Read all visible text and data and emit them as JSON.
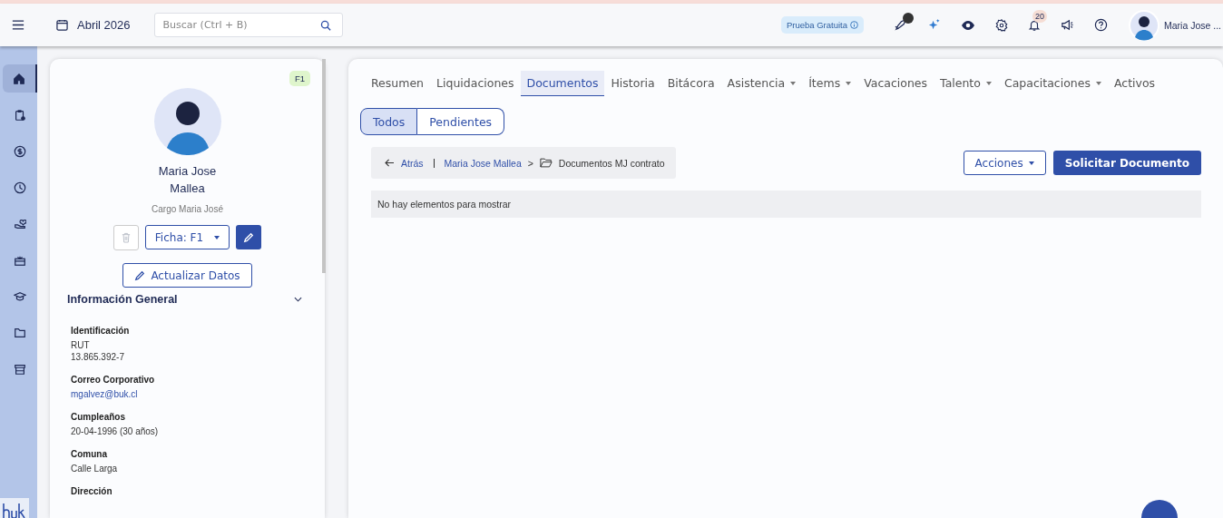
{
  "topbar": {
    "date": "Abril 2026",
    "search": {
      "placeholder": "Buscar (Ctrl + B)"
    },
    "trial": "Prueba Gratuita",
    "notifications": "20",
    "user": "Maria Jose ..."
  },
  "sidebar": {
    "items": [
      {
        "kind": "home",
        "selected": true
      },
      {
        "kind": "clipboard",
        "selected": false
      },
      {
        "kind": "dollar",
        "selected": false
      },
      {
        "kind": "clock",
        "selected": false
      },
      {
        "kind": "hand",
        "selected": false
      },
      {
        "kind": "gift",
        "selected": false
      },
      {
        "kind": "cap",
        "selected": false
      },
      {
        "kind": "folder",
        "selected": false
      },
      {
        "kind": "store",
        "selected": false
      }
    ]
  },
  "profile": {
    "badge": "F1",
    "name": "Maria Jose Mallea",
    "position": "Cargo Maria José",
    "sheet": "Ficha: F1",
    "update": "Actualizar Datos",
    "section": {
      "title": "Información General",
      "expanded": true,
      "fields": [
        {
          "label": "Identificación",
          "values": [
            "RUT",
            "13.865.392-7"
          ],
          "kind": "text"
        },
        {
          "label": "Correo Corporativo",
          "values": [
            "mgalvez@buk.cl"
          ],
          "kind": "link"
        },
        {
          "label": "Cumpleaños",
          "values": [
            "20-04-1996 (30 años)"
          ],
          "kind": "text"
        },
        {
          "label": "Comuna",
          "values": [
            "Calle Larga"
          ],
          "kind": "text"
        },
        {
          "label": "Dirección"
        }
      ]
    }
  },
  "tabs": [
    {
      "label": "Resumen",
      "selected": false,
      "menu": false
    },
    {
      "label": "Liquidaciones",
      "selected": false,
      "menu": false
    },
    {
      "label": "Documentos",
      "selected": true,
      "menu": false
    },
    {
      "label": "Historia",
      "selected": false,
      "menu": false
    },
    {
      "label": "Bitácora",
      "selected": false,
      "menu": false
    },
    {
      "label": "Asistencia",
      "selected": false,
      "menu": true
    },
    {
      "label": "Ítems",
      "selected": false,
      "menu": true
    },
    {
      "label": "Vacaciones",
      "selected": false,
      "menu": false
    },
    {
      "label": "Talento",
      "selected": false,
      "menu": true
    },
    {
      "label": "Capacitaciones",
      "selected": false,
      "menu": true
    },
    {
      "label": "Activos",
      "selected": false,
      "menu": false
    }
  ],
  "filters": [
    {
      "label": "Todos",
      "selected": true
    },
    {
      "label": "Pendientes",
      "selected": false
    }
  ],
  "breadcrumb": {
    "back": "Atrás",
    "person": "Maria Jose Mallea",
    "separator": ">",
    "folder": "Documentos MJ contrato"
  },
  "actions": {
    "menu": "Acciones",
    "primary": "Solicitar Documento"
  },
  "empty_message": "No hay elementos para mostrar"
}
